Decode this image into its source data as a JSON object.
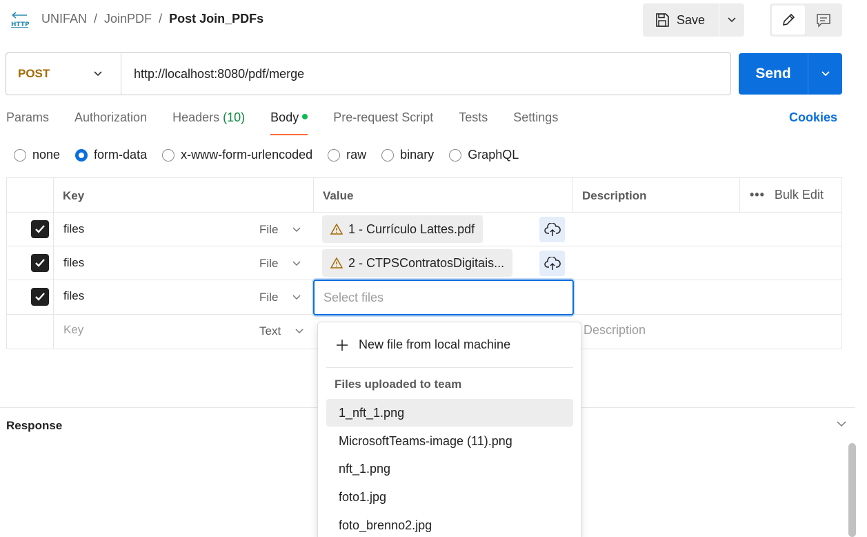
{
  "breadcrumb": {
    "items": [
      "UNIFAN",
      "JoinPDF"
    ],
    "separator": "/",
    "current": "Post Join_PDFs"
  },
  "http_icon_label": "HTTP",
  "toolbar": {
    "save_label": "Save"
  },
  "request": {
    "method": "POST",
    "method_color": "#a46a00",
    "url": "http://localhost:8080/pdf/merge",
    "send_label": "Send",
    "send_color": "#0b6fde"
  },
  "tabs": {
    "params": "Params",
    "authorization": "Authorization",
    "headers": "Headers",
    "headers_count": "(10)",
    "body": "Body",
    "prerequest": "Pre-request Script",
    "tests": "Tests",
    "settings": "Settings",
    "cookies": "Cookies",
    "active": "Body"
  },
  "body_types": {
    "none": "none",
    "form_data": "form-data",
    "urlencoded": "x-www-form-urlencoded",
    "raw": "raw",
    "binary": "binary",
    "graphql": "GraphQL",
    "selected": "form-data"
  },
  "table": {
    "headers": {
      "key": "Key",
      "value": "Value",
      "description": "Description",
      "bulk_edit": "Bulk Edit"
    },
    "rows": [
      {
        "checked": true,
        "key": "files",
        "type": "File",
        "value": "1 - Currículo Lattes.pdf"
      },
      {
        "checked": true,
        "key": "files",
        "type": "File",
        "value": "2 - CTPSContratosDigitais..."
      },
      {
        "checked": true,
        "key": "files",
        "type": "File",
        "value_placeholder": "Select files"
      }
    ],
    "new_row": {
      "key_placeholder": "Key",
      "type": "Text",
      "description_placeholder": "Description"
    }
  },
  "dropdown": {
    "new_file": "New file from local machine",
    "heading": "Files uploaded to team",
    "files": [
      "1_nft_1.png",
      "MicrosoftTeams-image (11).png",
      "nft_1.png",
      "foto1.jpg",
      "foto_brenno2.jpg"
    ],
    "highlighted": "1_nft_1.png"
  },
  "response": {
    "label": "Response"
  }
}
